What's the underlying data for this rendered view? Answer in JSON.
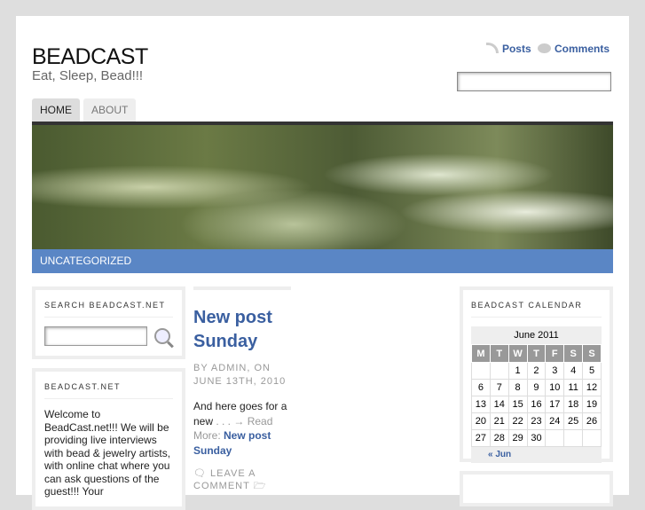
{
  "site": {
    "title": "BEADCAST",
    "tagline": "Eat, Sleep, Bead!!!"
  },
  "feeds": {
    "posts": "Posts",
    "comments": "Comments"
  },
  "nav": [
    {
      "label": "HOME"
    },
    {
      "label": "ABOUT"
    }
  ],
  "category_bar": "UNCATEGORIZED",
  "search_widget": {
    "title": "SEARCH BEADCAST.NET"
  },
  "about_widget": {
    "title": "BEADCAST.NET",
    "text": "Welcome to BeadCast.net!!! We will be providing live interviews with bead & jewelry artists, with online chat where you can ask questions of the guest!!! Your"
  },
  "post": {
    "title": "New post Sunday",
    "meta": "BY ADMIN, ON JUNE 13TH, 2010",
    "excerpt": "And here goes for a new",
    "ellipsis": " . . . → Read More: ",
    "read_more_link": "New post Sunday",
    "comment_link": "LEAVE A COMMENT"
  },
  "calendar": {
    "title": "BEADCAST CALENDAR",
    "caption": "June 2011",
    "headers": [
      "M",
      "T",
      "W",
      "T",
      "F",
      "S",
      "S"
    ],
    "weeks": [
      [
        "",
        "",
        "1",
        "2",
        "3",
        "4",
        "5"
      ],
      [
        "6",
        "7",
        "8",
        "9",
        "10",
        "11",
        "12"
      ],
      [
        "13",
        "14",
        "15",
        "16",
        "17",
        "18",
        "19"
      ],
      [
        "20",
        "21",
        "22",
        "23",
        "24",
        "25",
        "26"
      ],
      [
        "27",
        "28",
        "29",
        "30",
        "",
        "",
        ""
      ]
    ],
    "prev": "« Jun"
  }
}
